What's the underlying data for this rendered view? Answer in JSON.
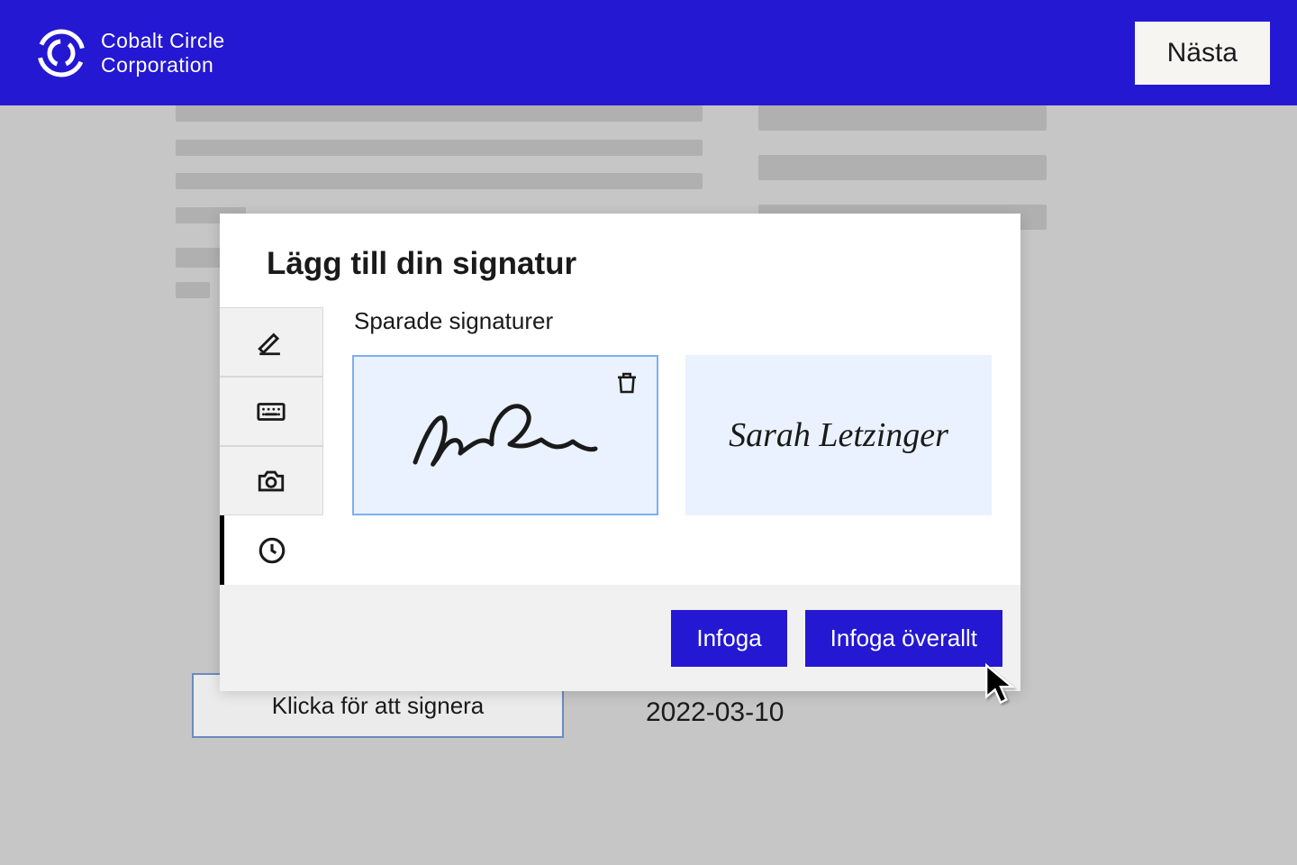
{
  "header": {
    "company_name": "Cobalt Circle\nCorporation",
    "next_label": "Nästa"
  },
  "page": {
    "sign_placeholder": "Klicka för att signera",
    "date_value": "2022-03-10"
  },
  "modal": {
    "title": "Lägg till din signatur",
    "saved_label": "Sparade signaturer",
    "signatures": [
      {
        "name": "handwritten-signature",
        "display": "SL (drawn)",
        "selected": true
      },
      {
        "name": "typed-signature",
        "display": "Sarah Letzinger",
        "selected": false
      }
    ],
    "tabs": [
      {
        "icon": "draw-icon",
        "active": false
      },
      {
        "icon": "keyboard-icon",
        "active": false
      },
      {
        "icon": "camera-icon",
        "active": false
      },
      {
        "icon": "clock-icon",
        "active": true
      }
    ],
    "actions": {
      "insert": "Infoga",
      "insert_all": "Infoga överallt"
    }
  }
}
